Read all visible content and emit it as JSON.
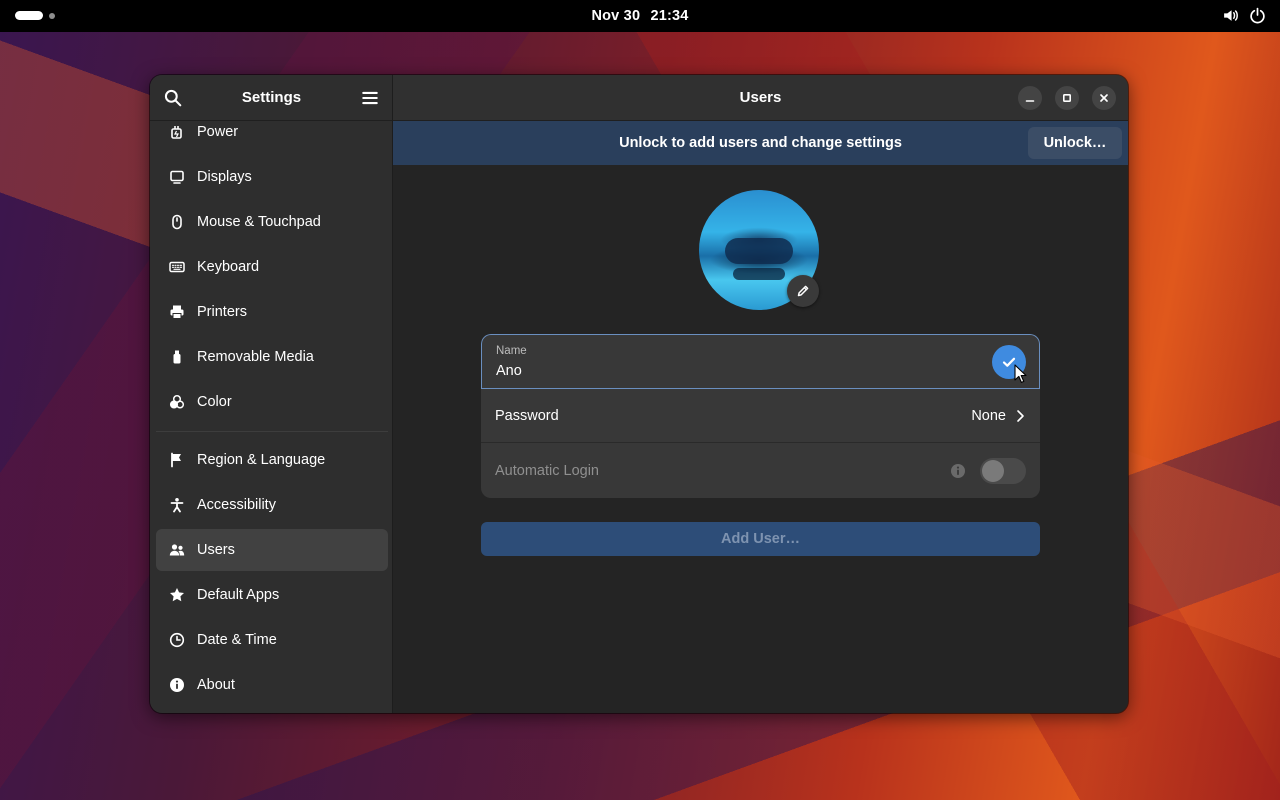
{
  "topbar": {
    "date": "Nov 30",
    "time": "21:34",
    "icons": [
      "activities-indicator",
      "volume-icon",
      "power-icon"
    ]
  },
  "sidebar": {
    "title": "Settings",
    "items": [
      {
        "label": "Power",
        "icon": "power-plug-icon"
      },
      {
        "label": "Displays",
        "icon": "display-icon"
      },
      {
        "label": "Mouse & Touchpad",
        "icon": "mouse-icon"
      },
      {
        "label": "Keyboard",
        "icon": "keyboard-icon"
      },
      {
        "label": "Printers",
        "icon": "printer-icon"
      },
      {
        "label": "Removable Media",
        "icon": "usb-icon"
      },
      {
        "label": "Color",
        "icon": "color-icon"
      },
      {
        "label": "Region & Language",
        "icon": "flag-icon"
      },
      {
        "label": "Accessibility",
        "icon": "accessibility-icon"
      },
      {
        "label": "Users",
        "icon": "users-icon",
        "active": true
      },
      {
        "label": "Default Apps",
        "icon": "star-icon"
      },
      {
        "label": "Date & Time",
        "icon": "clock-icon"
      },
      {
        "label": "About",
        "icon": "info-icon"
      }
    ]
  },
  "content": {
    "title": "Users",
    "banner": {
      "text": "Unlock to add users and change settings",
      "button": "Unlock…"
    },
    "name_field": {
      "label": "Name",
      "value": "Ano"
    },
    "password": {
      "label": "Password",
      "value": "None"
    },
    "auto_login": {
      "label": "Automatic Login",
      "enabled": false
    },
    "add_user_button": "Add User…"
  },
  "colors": {
    "accent": "#3f8be0",
    "banner": "#2a3f5c",
    "window_bg": "#242424",
    "sidebar_bg": "#2e2e2e"
  }
}
